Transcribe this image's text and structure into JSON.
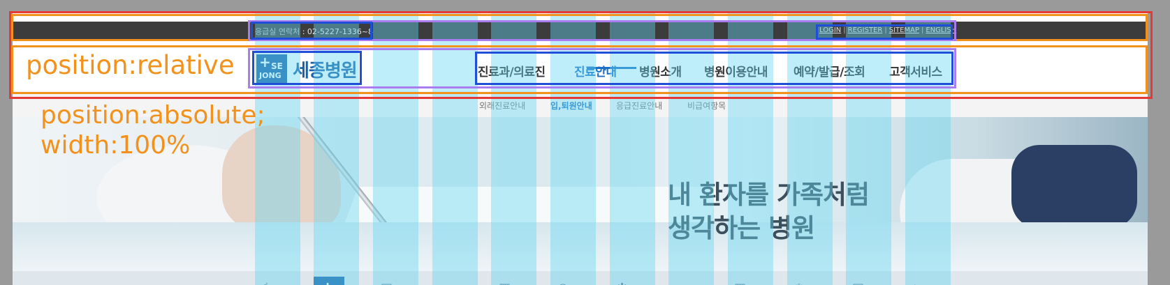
{
  "utility": {
    "emergency_label": "응급실 연락처",
    "emergency_phone": ": 02-5227-1336~8",
    "links": [
      "LOGIN",
      "REGISTER",
      "SITEMAP",
      "ENGLISH"
    ]
  },
  "logo": {
    "mark_se": "SE",
    "mark_jong": "JONG",
    "text": "세종병원"
  },
  "gnb": {
    "items": [
      "진료과/의료진",
      "진료안내",
      "병원소개",
      "병원이용안내",
      "예약/발급/조회",
      "고객서비스"
    ],
    "active": "진료안내"
  },
  "subnav": {
    "items": [
      "외래진료안내",
      "입,퇴원안내",
      "응급진료안내",
      "비급여항목"
    ],
    "active": "입,퇴원안내"
  },
  "hero": {
    "line1": "내 환자를 가족처럼",
    "line2": "생각하는 병원"
  },
  "annotations": {
    "relative": "position:relative",
    "absolute_line1": "position:absolute;",
    "absolute_line2": "width:100%"
  },
  "colors": {
    "brand": "#1b5fa6",
    "active_nav": "#1b6fc4",
    "utility_bg": "#3c3c3c",
    "annotation": "#f2921c",
    "box_red": "#e53935",
    "box_orange": "#f2921c",
    "box_purple": "#a97cf0",
    "box_blue": "#1f4fd8",
    "grid_column": "rgba(100,215,240,0.42)"
  },
  "quick_icons": [
    "stethoscope-icon",
    "doctor-icon",
    "clipboard-icon",
    "ambulance-icon",
    "document-icon",
    "car-icon",
    "medicine-icon",
    "search-icon",
    "folder-icon",
    "chat-icon",
    "calendar-icon",
    "hospital-icon"
  ]
}
